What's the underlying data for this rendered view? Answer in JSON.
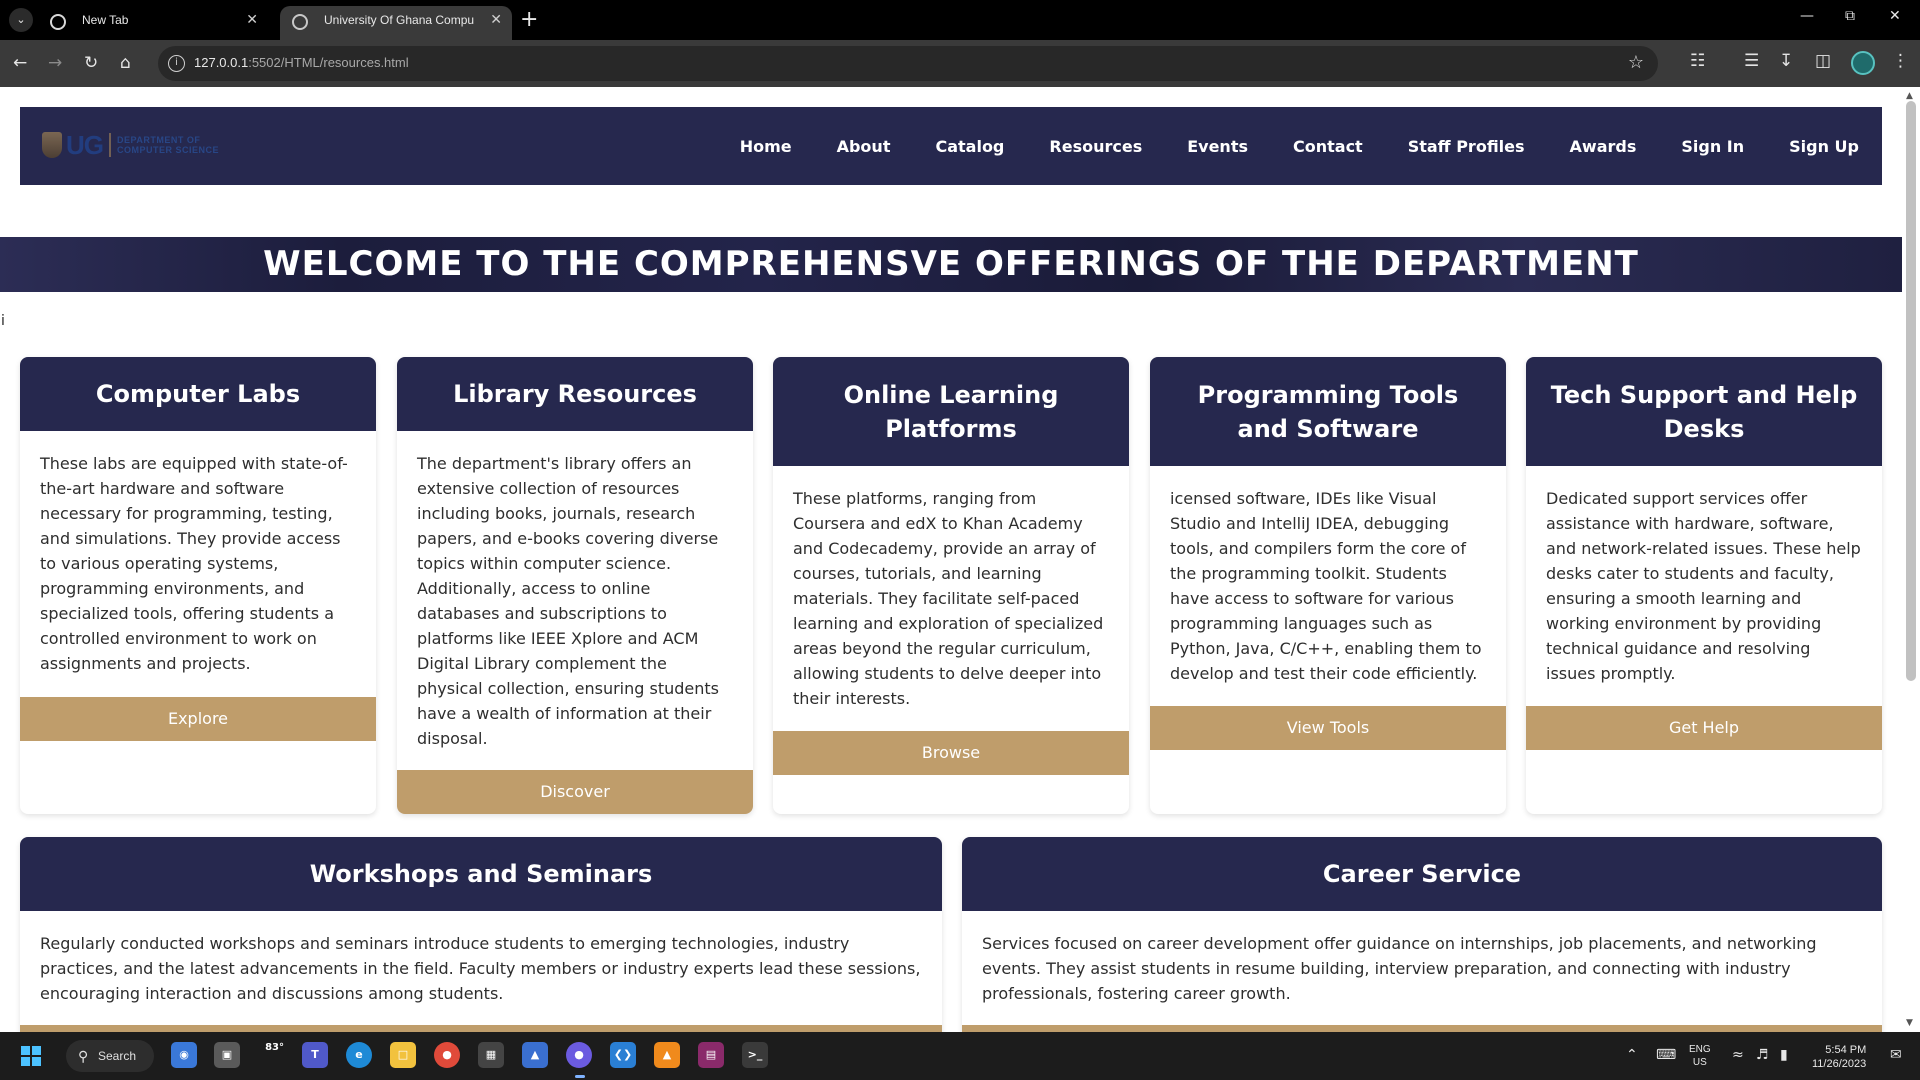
{
  "browser": {
    "tabs": [
      {
        "title": "New Tab",
        "active": false
      },
      {
        "title": "University Of Ghana Computer",
        "active": true
      }
    ],
    "url_host": "127.0.0.1",
    "url_rest": ":5502/HTML/resources.html"
  },
  "site": {
    "logo": {
      "abbrev": "UG",
      "line1": "DEPARTMENT OF",
      "line2": "COMPUTER SCIENCE"
    },
    "nav": [
      "Home",
      "About",
      "Catalog",
      "Resources",
      "Events",
      "Contact",
      "Staff Profiles",
      "Awards",
      "Sign In",
      "Sign Up"
    ],
    "hero_title": "WELCOME TO THE COMPREHENSVE OFFERINGS OF THE DEPARTMENT",
    "stray_text": "i",
    "colors": {
      "navy": "#26284e",
      "gold": "#bf9d6b"
    }
  },
  "cards": [
    {
      "title": "Computer Labs",
      "text": "These labs are equipped with state-of-the-art hardware and software necessary for programming, testing, and simulations. They provide access to various operating systems, programming environments, and specialized tools, offering students a controlled environment to work on assignments and projects.",
      "button": "Explore"
    },
    {
      "title": "Library Resources",
      "text": "The department's library offers an extensive collection of resources including books, journals, research papers, and e-books covering diverse topics within computer science. Additionally, access to online databases and subscriptions to platforms like IEEE Xplore and ACM Digital Library complement the physical collection, ensuring students have a wealth of information at their disposal.",
      "button": "Discover"
    },
    {
      "title": "Online Learning Platforms",
      "text": "These platforms, ranging from Coursera and edX to Khan Academy and Codecademy, provide an array of courses, tutorials, and learning materials. They facilitate self-paced learning and exploration of specialized areas beyond the regular curriculum, allowing students to delve deeper into their interests.",
      "button": "Browse"
    },
    {
      "title": "Programming Tools and Software",
      "text": "icensed software, IDEs like Visual Studio and IntelliJ IDEA, debugging tools, and compilers form the core of the programming toolkit. Students have access to software for various programming languages such as Python, Java, C/C++, enabling them to develop and test their code efficiently.",
      "button": "View Tools"
    },
    {
      "title": "Tech Support and Help Desks",
      "text": "Dedicated support services offer assistance with hardware, software, and network-related issues. These help desks cater to students and faculty, ensuring a smooth learning and working environment by providing technical guidance and resolving issues promptly.",
      "button": "Get Help"
    },
    {
      "title": "Workshops and Seminars",
      "text": "Regularly conducted workshops and seminars introduce students to emerging technologies, industry practices, and the latest advancements in the field. Faculty members or industry experts lead these sessions, encouraging interaction and discussions among students."
    },
    {
      "title": "Career Service",
      "text": "Services focused on career development offer guidance on internships, job placements, and networking events. They assist students in resume building, interview preparation, and connecting with industry professionals, fostering career growth."
    }
  ],
  "taskbar": {
    "search_label": "Search",
    "weather_temp": "83°",
    "lang_line1": "ENG",
    "lang_line2": "US",
    "time": "5:54 PM",
    "date": "11/26/2023"
  }
}
